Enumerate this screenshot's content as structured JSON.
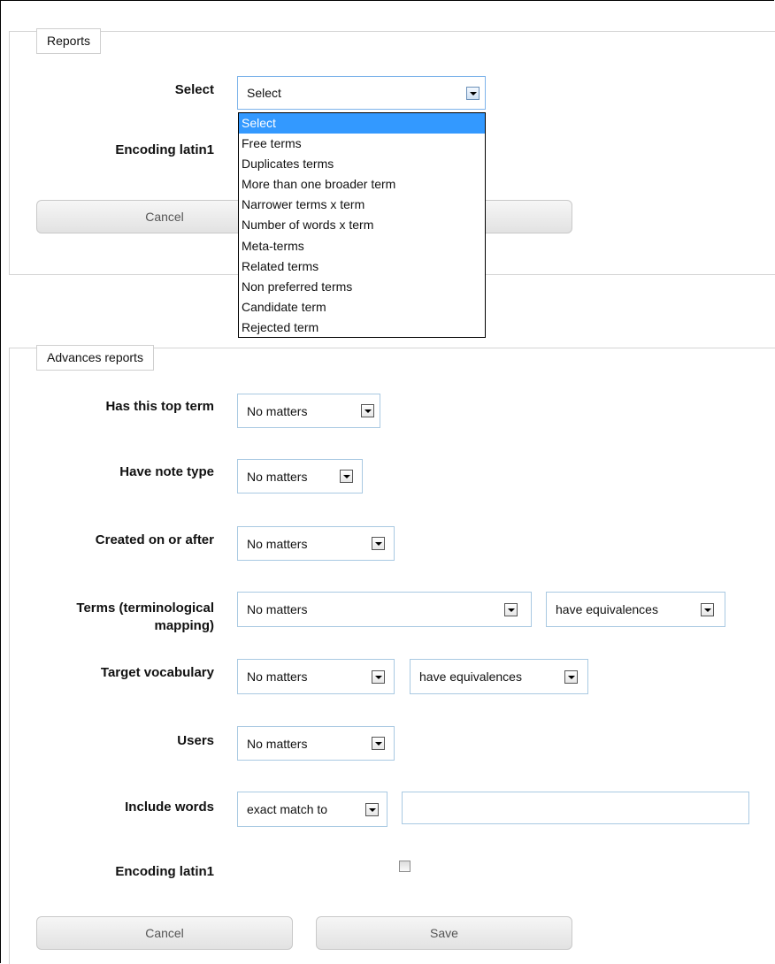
{
  "reports": {
    "legend": "Reports",
    "select_label": "Select",
    "select_value": "Select",
    "encoding_label": "Encoding latin1",
    "cancel_label": "Cancel",
    "dropdown_options": [
      "Select",
      "Free terms",
      "Duplicates terms",
      "More than one broader term",
      "Narrower terms x term",
      "Number of words x term",
      "Meta-terms",
      "Related terms",
      "Non preferred terms",
      "Candidate term",
      "Rejected term"
    ]
  },
  "advanced": {
    "legend": "Advances reports",
    "top_term": {
      "label": "Has this top term",
      "value": "No matters"
    },
    "note_type": {
      "label": "Have note type",
      "value": "No matters"
    },
    "created": {
      "label": "Created on or after",
      "value": "No matters"
    },
    "terms_mapping": {
      "label": "Terms (terminological mapping)",
      "value": "No matters",
      "equiv_value": "have equivalences"
    },
    "target_vocab": {
      "label": "Target vocabulary",
      "value": "No matters",
      "equiv_value": "have equivalences"
    },
    "users": {
      "label": "Users",
      "value": "No matters"
    },
    "include_words": {
      "label": "Include words",
      "value": "exact match to",
      "input_value": ""
    },
    "encoding_label": "Encoding latin1",
    "cancel_label": "Cancel",
    "save_label": "Save"
  }
}
